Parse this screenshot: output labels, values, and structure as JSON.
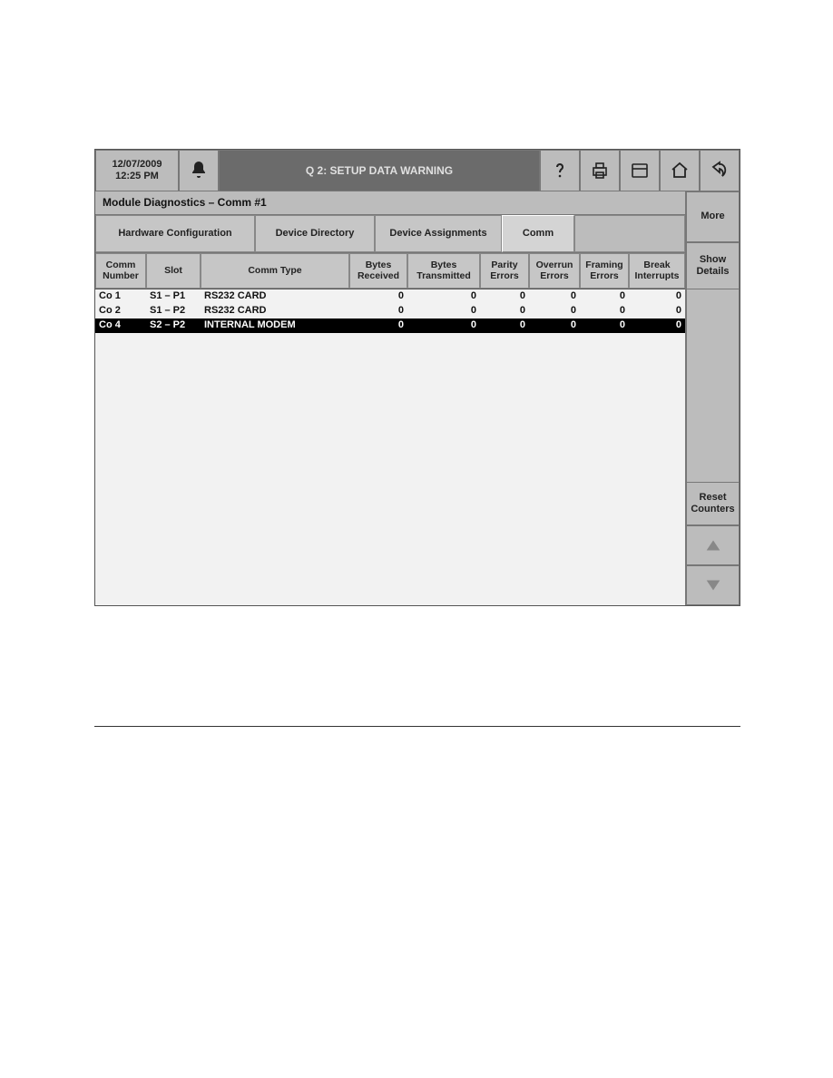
{
  "topbar": {
    "date": "12/07/2009",
    "time": "12:25 PM",
    "title": "Q 2: SETUP DATA WARNING"
  },
  "breadcrumb": "Module Diagnostics  –  Comm #1",
  "tabs": {
    "hardware": "Hardware Configuration",
    "device_dir": "Device Directory",
    "device_assign": "Device Assignments",
    "comm": "Comm"
  },
  "columns": {
    "comm_number": "Comm Number",
    "slot": "Slot",
    "comm_type": "Comm Type",
    "bytes_received": "Bytes Received",
    "bytes_transmitted": "Bytes Transmitted",
    "parity_errors": "Parity Errors",
    "overrun_errors": "Overrun Errors",
    "framing_errors": "Framing Errors",
    "break_interrupts": "Break Interrupts"
  },
  "rows": [
    {
      "comm_number": "Co 1",
      "slot": "S1 – P1",
      "comm_type": "RS232 CARD",
      "bytes_received": "0",
      "bytes_transmitted": "0",
      "parity_errors": "0",
      "overrun_errors": "0",
      "framing_errors": "0",
      "break_interrupts": "0",
      "selected": false
    },
    {
      "comm_number": "Co 2",
      "slot": "S1 – P2",
      "comm_type": "RS232 CARD",
      "bytes_received": "0",
      "bytes_transmitted": "0",
      "parity_errors": "0",
      "overrun_errors": "0",
      "framing_errors": "0",
      "break_interrupts": "0",
      "selected": false
    },
    {
      "comm_number": "Co 4",
      "slot": "S2 – P2",
      "comm_type": "INTERNAL MODEM",
      "bytes_received": "0",
      "bytes_transmitted": "0",
      "parity_errors": "0",
      "overrun_errors": "0",
      "framing_errors": "0",
      "break_interrupts": "0",
      "selected": true
    }
  ],
  "sidebar": {
    "more": "More",
    "show_details": "Show Details",
    "reset": "Reset Counters"
  }
}
